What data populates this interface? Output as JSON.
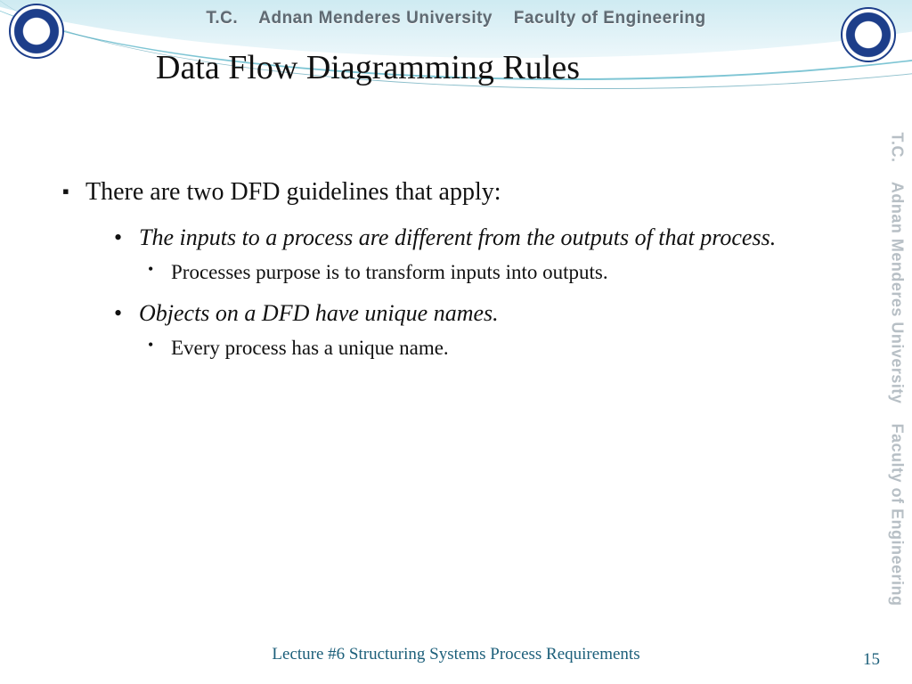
{
  "header": {
    "tc": "T.C.",
    "university": "Adnan Menderes University",
    "faculty": "Faculty of Engineering"
  },
  "slide": {
    "title": "Data Flow Diagramming Rules"
  },
  "bullets": {
    "lvl1": "There are two DFD guidelines that apply:",
    "g1": "The inputs to a process are different from the outputs of that process.",
    "g1_sub": "Processes purpose is to transform inputs into outputs.",
    "g2": "Objects on a DFD have unique names.",
    "g2_sub": "Every process has a unique name."
  },
  "footer": {
    "title": "Lecture #6 Structuring Systems Process Requirements",
    "page": "15"
  },
  "side": {
    "tc": "T.C.",
    "university": "Adnan Menderes University",
    "faculty": "Faculty of Engineering"
  }
}
